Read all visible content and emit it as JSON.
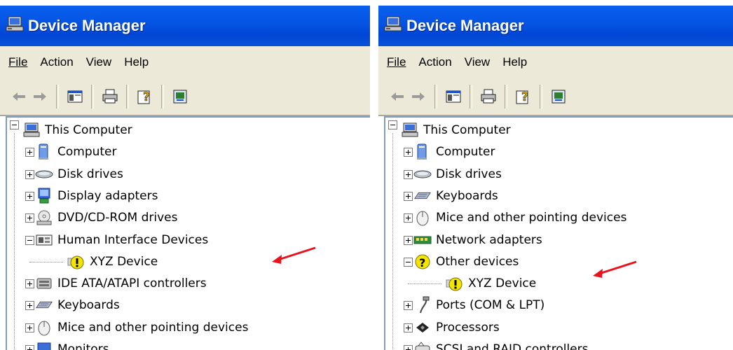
{
  "window_title": "Device Manager",
  "menus": [
    "File",
    "Action",
    "View",
    "Help"
  ],
  "colors": {
    "titlebar": "#0553e2",
    "chrome": "#ece9d8",
    "arrow": "#e8141b",
    "warning": "#f3e500"
  },
  "left": {
    "root": "This Computer",
    "items": [
      {
        "label": "Computer",
        "icon": "computer-icon"
      },
      {
        "label": "Disk drives",
        "icon": "disk-drive-icon"
      },
      {
        "label": "Display adapters",
        "icon": "display-adapter-icon"
      },
      {
        "label": "DVD/CD-ROM drives",
        "icon": "cdrom-icon"
      },
      {
        "label": "Human Interface Devices",
        "icon": "hid-icon",
        "expanded": true
      },
      {
        "label": "XYZ Device",
        "icon": "warning-device-icon",
        "child": true
      },
      {
        "label": "IDE ATA/ATAPI controllers",
        "icon": "ide-controller-icon"
      },
      {
        "label": "Keyboards",
        "icon": "keyboard-icon"
      },
      {
        "label": "Mice and other pointing devices",
        "icon": "mouse-icon"
      },
      {
        "label": "Monitors",
        "icon": "monitor-icon"
      }
    ]
  },
  "right": {
    "root": "This Computer",
    "items": [
      {
        "label": "Computer",
        "icon": "computer-icon"
      },
      {
        "label": "Disk drives",
        "icon": "disk-drive-icon"
      },
      {
        "label": "Keyboards",
        "icon": "keyboard-icon"
      },
      {
        "label": "Mice and other pointing devices",
        "icon": "mouse-icon"
      },
      {
        "label": "Network adapters",
        "icon": "network-adapter-icon"
      },
      {
        "label": "Other devices",
        "icon": "unknown-device-icon",
        "expanded": true
      },
      {
        "label": "XYZ Device",
        "icon": "warning-device-icon",
        "child": true
      },
      {
        "label": "Ports (COM & LPT)",
        "icon": "port-icon"
      },
      {
        "label": "Processors",
        "icon": "processor-icon"
      },
      {
        "label": "SCSI and RAID controllers",
        "icon": "scsi-controller-icon"
      }
    ]
  }
}
